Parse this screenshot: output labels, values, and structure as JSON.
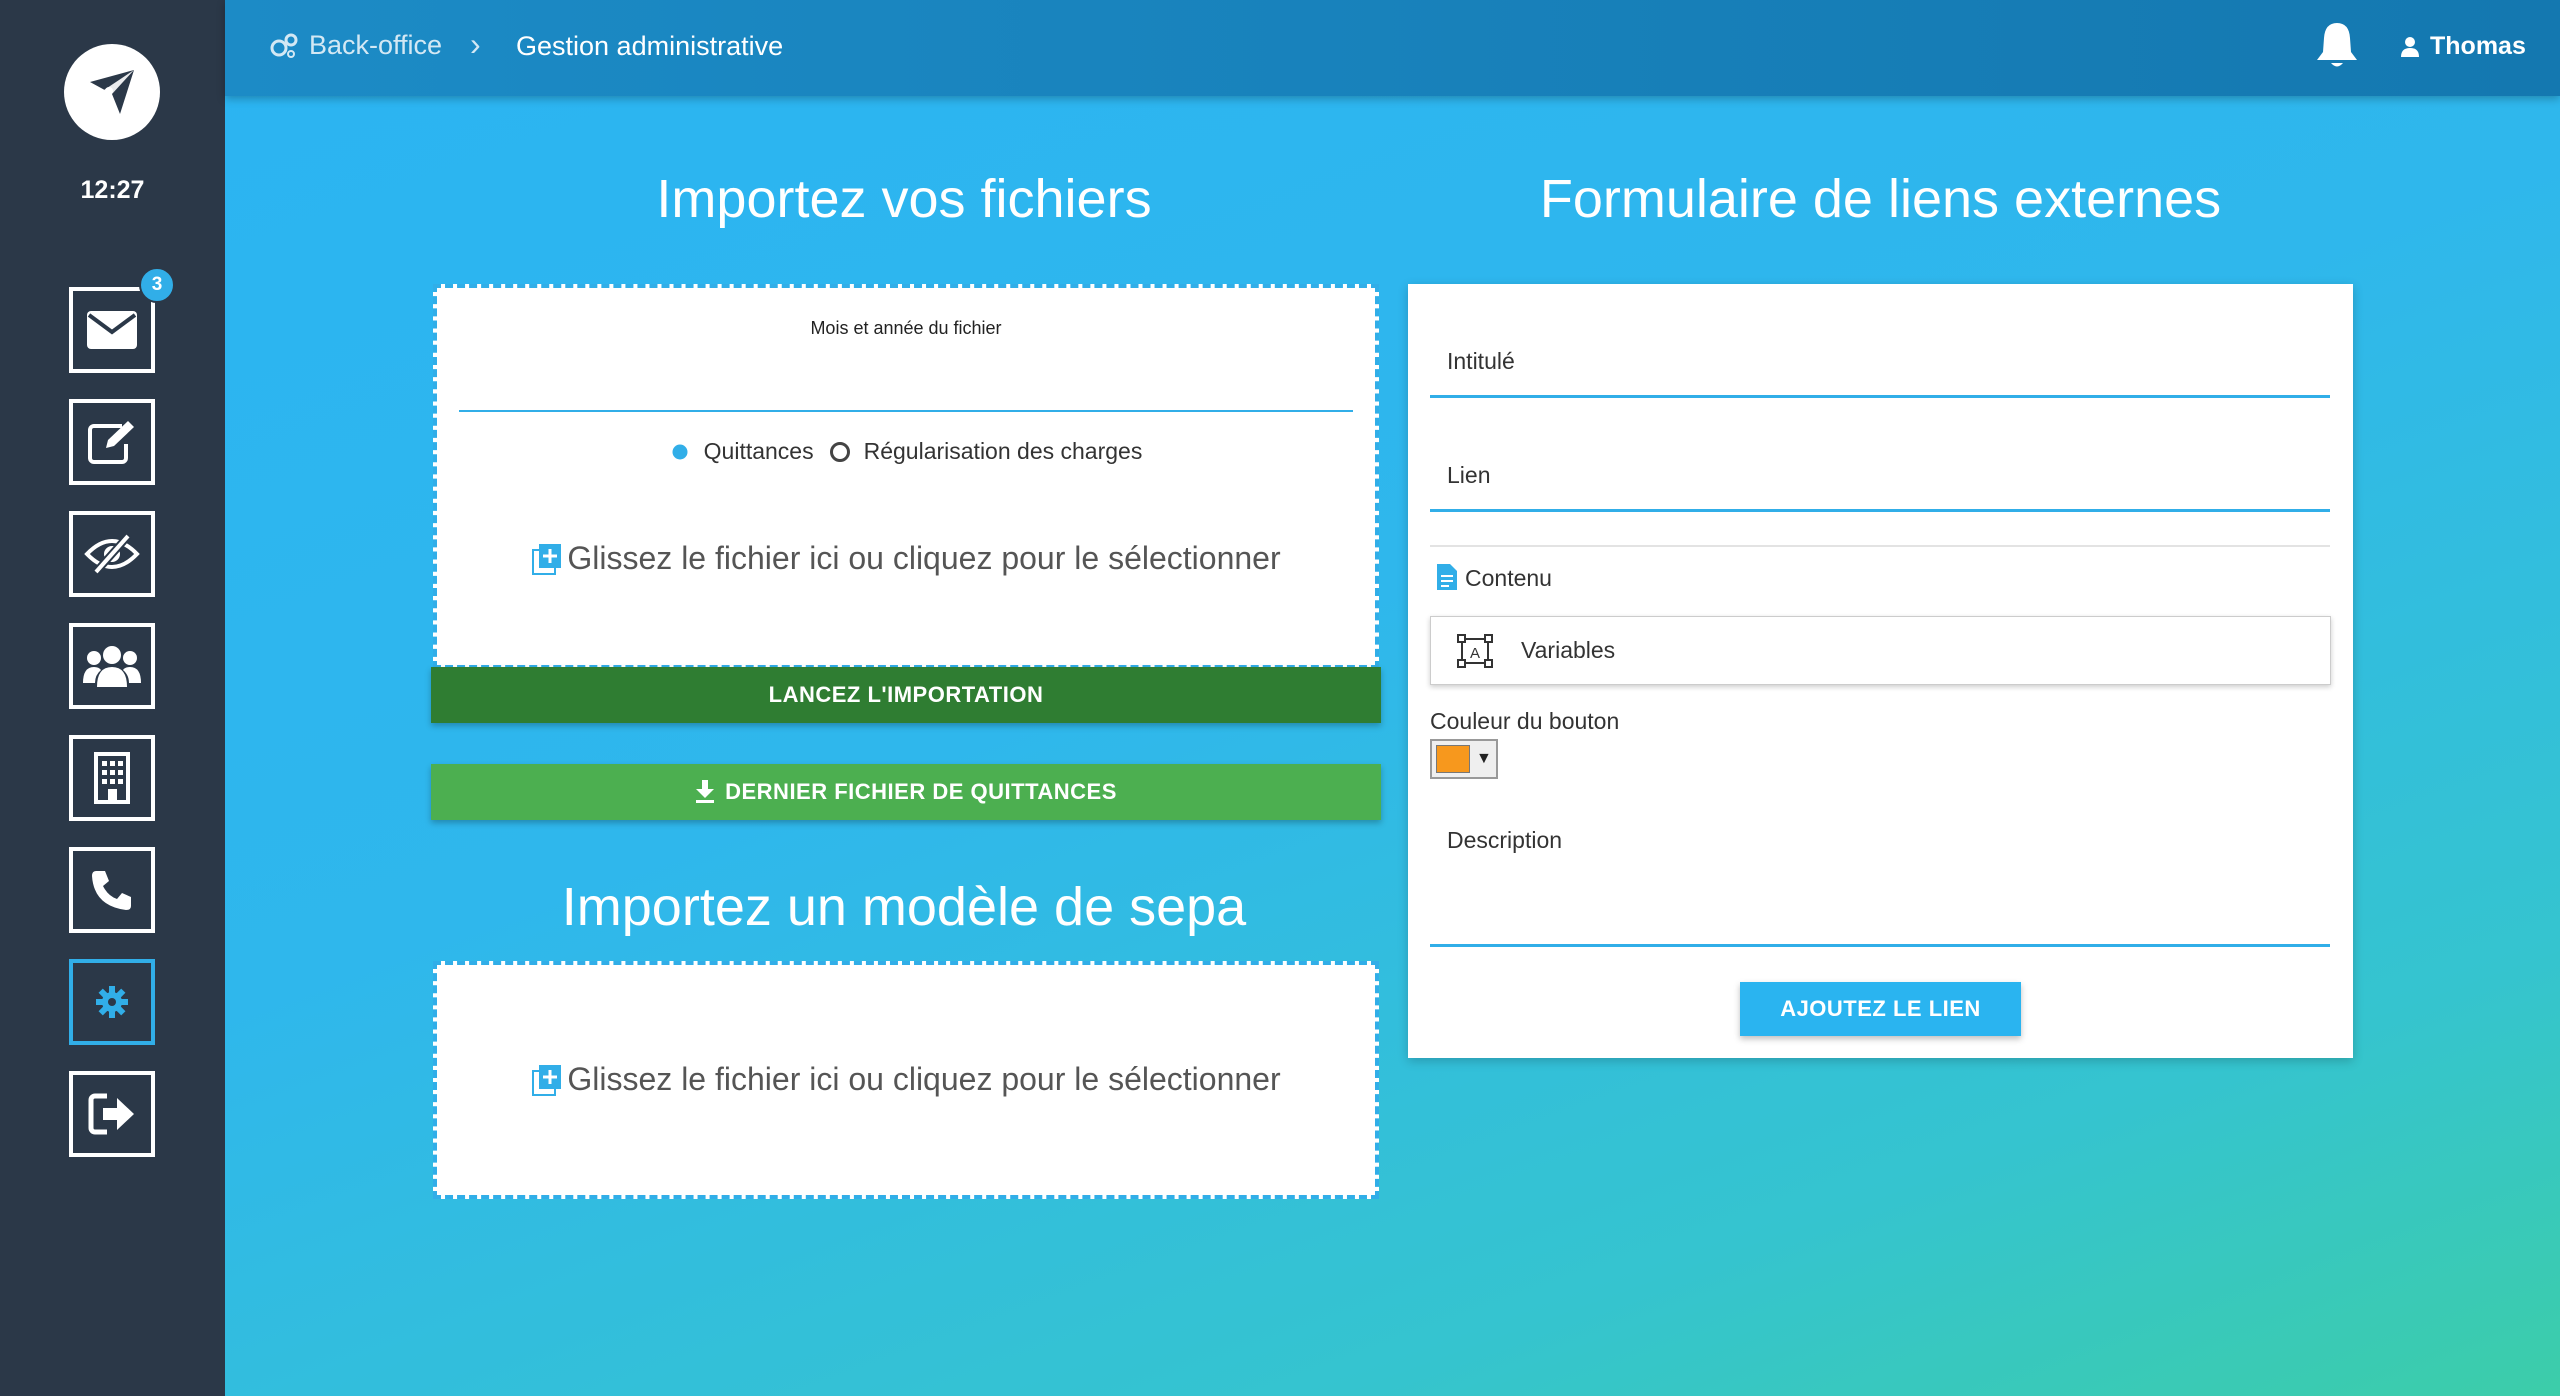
{
  "sidebar": {
    "time": "12:27",
    "mail_badge": "3",
    "items": [
      {
        "icon": "envelope-icon"
      },
      {
        "icon": "edit-icon"
      },
      {
        "icon": "eye-slash-icon"
      },
      {
        "icon": "users-icon"
      },
      {
        "icon": "building-icon"
      },
      {
        "icon": "phone-icon"
      },
      {
        "icon": "gear-icon",
        "active": true
      },
      {
        "icon": "logout-icon"
      }
    ]
  },
  "header": {
    "breadcrumb_root": "Back-office",
    "breadcrumb_current": "Gestion administrative",
    "user_name": "Thomas"
  },
  "import_files": {
    "title": "Importez vos fichiers",
    "month_label": "Mois et année du fichier",
    "radio_options": [
      "Quittances",
      "Régularisation des charges"
    ],
    "selected_option": "Quittances",
    "dropzone_text": "Glissez le fichier ici ou cliquez pour le sélectionner",
    "launch_button": "LANCEZ L'IMPORTATION",
    "download_button": "DERNIER FICHIER DE QUITTANCES"
  },
  "import_sepa": {
    "title": "Importez un modèle de sepa",
    "dropzone_text": "Glissez le fichier ici ou cliquez pour le sélectionner"
  },
  "external_links": {
    "title": "Formulaire de liens externes",
    "label_field": "Intitulé",
    "link_field": "Lien",
    "content_label": "Contenu",
    "variables_label": "Variables",
    "button_color_label": "Couleur du bouton",
    "button_color": "#f7981d",
    "description_label": "Description",
    "submit_button": "AJOUTEZ LE LIEN"
  }
}
